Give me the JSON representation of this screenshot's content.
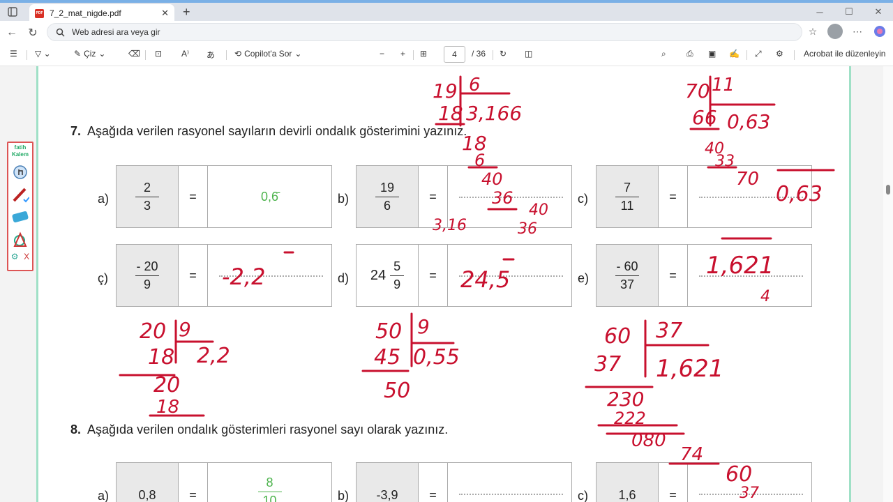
{
  "browser": {
    "tab_title": "7_2_mat_nigde.pdf",
    "address_placeholder": "Web adresi ara veya gir"
  },
  "pdf_toolbar": {
    "draw_label": "Çiz",
    "copilot_label": "Copilot'a Sor",
    "current_page": "4",
    "total_pages": "/ 36",
    "acrobat_label": "Acrobat ile düzenleyin"
  },
  "question7": {
    "number": "7.",
    "text": "Aşağıda verilen rasyonel sayıların devirli ondalık gösterimini yazınız.",
    "items": [
      {
        "label": "a)",
        "num": "2",
        "den": "3",
        "equals": "=",
        "answer": "0,6̄"
      },
      {
        "label": "b)",
        "num": "19",
        "den": "6",
        "equals": "="
      },
      {
        "label": "c)",
        "num": "7",
        "den": "11",
        "equals": "="
      },
      {
        "label": "ç)",
        "num": "- 20",
        "den": "9",
        "equals": "="
      },
      {
        "label": "d)",
        "whole": "24",
        "num": "5",
        "den": "9",
        "equals": "="
      },
      {
        "label": "e)",
        "num": "- 60",
        "den": "37",
        "equals": "="
      }
    ]
  },
  "question8": {
    "number": "8.",
    "text": "Aşağıda verilen ondalık gösterimleri rasyonel sayı olarak yazınız.",
    "items": [
      {
        "label": "a)",
        "value": "0,8",
        "equals": "=",
        "answer_num": "8",
        "answer_den": "10"
      },
      {
        "label": "b)",
        "value": "-3,9",
        "equals": "="
      },
      {
        "label": "c)",
        "value": "1,6",
        "equals": "="
      }
    ]
  },
  "handwriting": {
    "b_top": [
      "19",
      "6",
      "18",
      "3,166",
      "18",
      "6",
      "40",
      "36",
      "40",
      "36"
    ],
    "b_answer": "3,16",
    "c_top": [
      "70",
      "11",
      "66",
      "0,63",
      "40",
      "33",
      "70"
    ],
    "c_answer": "0,63",
    "c_ans": "-2,2",
    "d_ans": "24,5",
    "e_ans": "1,621",
    "e_note": "4",
    "div_20_9": [
      "20",
      "9",
      "18",
      "2,2",
      "20",
      "18"
    ],
    "div_50_9": [
      "50",
      "9",
      "45",
      "0,55",
      "50"
    ],
    "div_60_37": [
      "60",
      "37",
      "37",
      "1,621",
      "230",
      "222",
      "080",
      "74",
      "60",
      "37"
    ]
  },
  "kalem": {
    "logo": "fatih Kalem",
    "close": "X"
  }
}
